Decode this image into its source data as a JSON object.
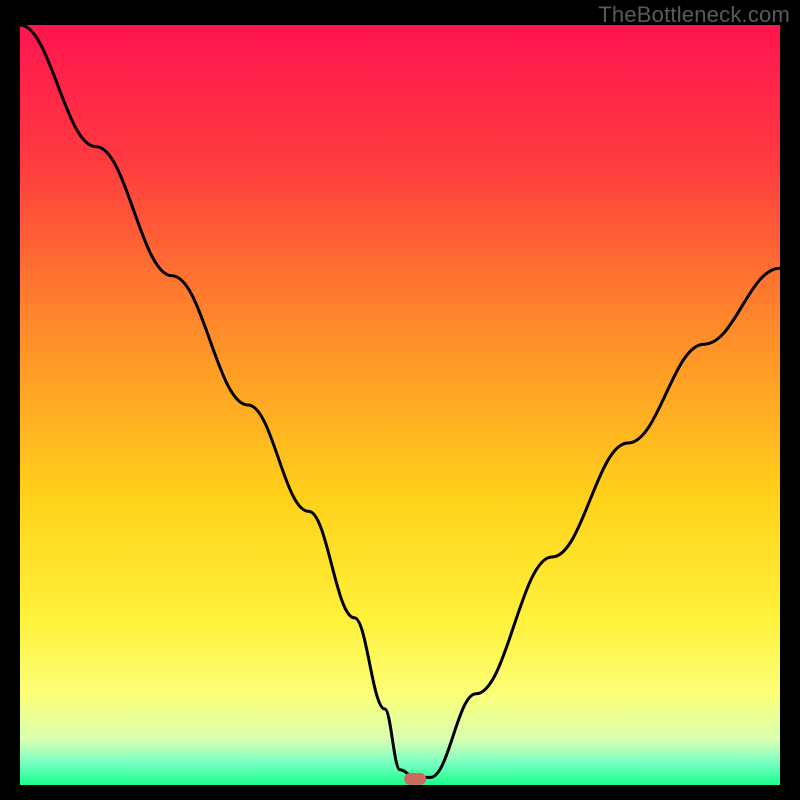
{
  "watermark": {
    "text": "TheBottleneck.com"
  },
  "chart_data": {
    "type": "line",
    "title": "",
    "xlabel": "",
    "ylabel": "",
    "xlim": [
      0,
      100
    ],
    "ylim": [
      0,
      100
    ],
    "series": [
      {
        "name": "bottleneck-curve",
        "x": [
          0,
          10,
          20,
          30,
          38,
          44,
          48,
          50,
          52,
          54,
          60,
          70,
          80,
          90,
          100
        ],
        "y": [
          100,
          84,
          67,
          50,
          36,
          22,
          10,
          2,
          1,
          1,
          12,
          30,
          45,
          58,
          68
        ]
      }
    ],
    "marker": {
      "x": 52,
      "y": 0.8,
      "color": "#c96a5f"
    },
    "gradient_stops": [
      {
        "offset": 0,
        "color": "#ff1450"
      },
      {
        "offset": 18,
        "color": "#ff3b3f"
      },
      {
        "offset": 40,
        "color": "#ff8b2a"
      },
      {
        "offset": 62,
        "color": "#ffd11a"
      },
      {
        "offset": 78,
        "color": "#fff13a"
      },
      {
        "offset": 88,
        "color": "#fcff77"
      },
      {
        "offset": 94,
        "color": "#d9ffb0"
      },
      {
        "offset": 97,
        "color": "#7affc4"
      },
      {
        "offset": 100,
        "color": "#1aff8b"
      }
    ]
  }
}
